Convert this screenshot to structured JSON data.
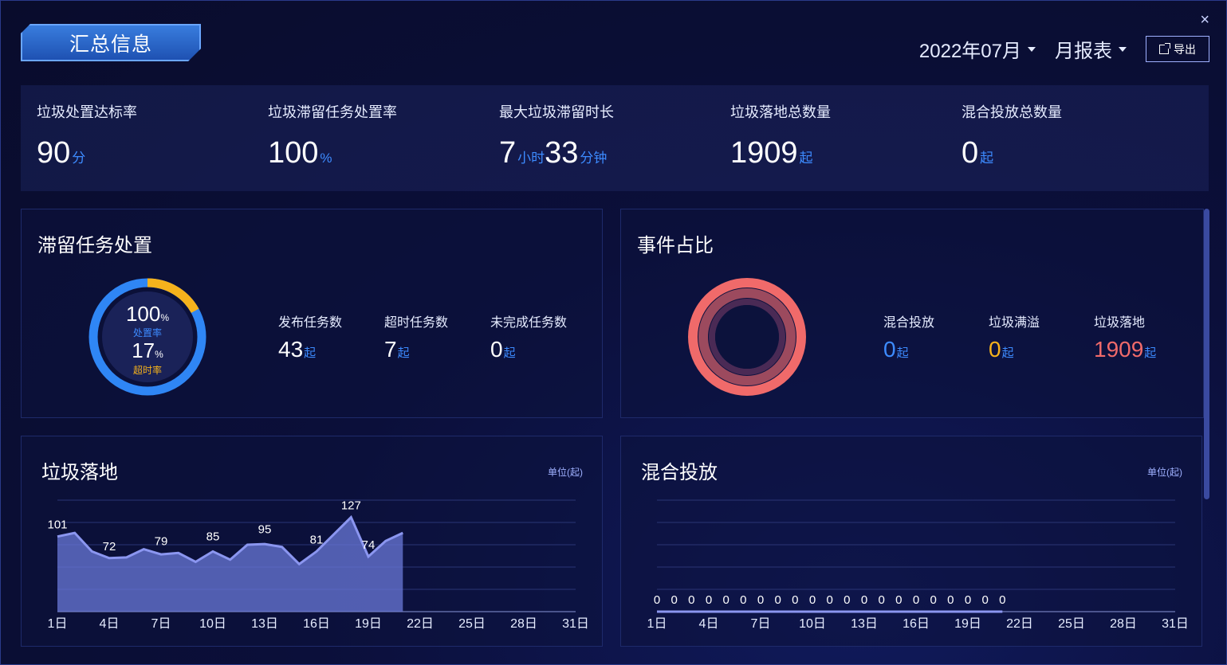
{
  "header": {
    "title": "汇总信息",
    "close_label": "×",
    "month_select": "2022年07月",
    "report_select": "月报表",
    "export_label": "导出"
  },
  "kpis": [
    {
      "label": "垃圾处置达标率",
      "value": "90",
      "unit": "分"
    },
    {
      "label": "垃圾滞留任务处置率",
      "value": "100",
      "unit": "%"
    },
    {
      "label": "最大垃圾滞留时长",
      "value": "7",
      "unit": "小时",
      "value2": "33",
      "unit2": "分钟"
    },
    {
      "label": "垃圾落地总数量",
      "value": "1909",
      "unit": "起"
    },
    {
      "label": "混合投放总数量",
      "value": "0",
      "unit": "起"
    }
  ],
  "retention": {
    "title": "滞留任务处置",
    "ring": {
      "top_value": "100",
      "top_unit": "%",
      "top_label": "处置率",
      "bottom_value": "17",
      "bottom_unit": "%",
      "bottom_label": "超时率",
      "overtime_fraction": 0.17
    },
    "stats": [
      {
        "label": "发布任务数",
        "value": "43",
        "unit": "起"
      },
      {
        "label": "超时任务数",
        "value": "7",
        "unit": "起"
      },
      {
        "label": "未完成任务数",
        "value": "0",
        "unit": "起"
      }
    ]
  },
  "events": {
    "title": "事件占比",
    "stats": [
      {
        "label": "混合投放",
        "value": "0",
        "unit": "起",
        "color": "#3d8bff"
      },
      {
        "label": "垃圾满溢",
        "value": "0",
        "unit": "起",
        "color": "#f5b21c"
      },
      {
        "label": "垃圾落地",
        "value": "1909",
        "unit": "起",
        "color": "#f06a6a"
      }
    ]
  },
  "colors": {
    "accent": "#3d8bff",
    "warning": "#f5b21c",
    "danger": "#f06a6a",
    "area": "#6a78d8"
  },
  "chart_data": [
    {
      "type": "area",
      "title": "垃圾落地",
      "unit_note": "单位(起)",
      "x_ticks": [
        "1日",
        "4日",
        "7日",
        "10日",
        "13日",
        "16日",
        "19日",
        "22日",
        "25日",
        "28日",
        "31日"
      ],
      "x": [
        1,
        2,
        3,
        4,
        5,
        6,
        7,
        8,
        9,
        10,
        11,
        12,
        13,
        14,
        15,
        16,
        17,
        18,
        19,
        20,
        21
      ],
      "values": [
        101,
        106,
        81,
        72,
        73,
        84,
        77,
        79,
        67,
        81,
        70,
        90,
        91,
        87,
        64,
        81,
        104,
        127,
        74,
        95,
        106
      ],
      "labels": [
        {
          "x": 1,
          "y": 101,
          "text": "101"
        },
        {
          "x": 4,
          "y": 72,
          "text": "72"
        },
        {
          "x": 7,
          "y": 79,
          "text": "79"
        },
        {
          "x": 10,
          "y": 85,
          "text": "85"
        },
        {
          "x": 13,
          "y": 95,
          "text": "95"
        },
        {
          "x": 16,
          "y": 81,
          "text": "81"
        },
        {
          "x": 18,
          "y": 127,
          "text": "127"
        },
        {
          "x": 19,
          "y": 74,
          "text": "74"
        }
      ],
      "xlim": [
        1,
        31
      ],
      "ylim": [
        0,
        150
      ],
      "grid": true
    },
    {
      "type": "area",
      "title": "混合投放",
      "unit_note": "单位(起)",
      "x_ticks": [
        "1日",
        "4日",
        "7日",
        "10日",
        "13日",
        "16日",
        "19日",
        "22日",
        "25日",
        "28日",
        "31日"
      ],
      "x": [
        1,
        2,
        3,
        4,
        5,
        6,
        7,
        8,
        9,
        10,
        11,
        12,
        13,
        14,
        15,
        16,
        17,
        18,
        19,
        20,
        21
      ],
      "values": [
        0,
        0,
        0,
        0,
        0,
        0,
        0,
        0,
        0,
        0,
        0,
        0,
        0,
        0,
        0,
        0,
        0,
        0,
        0,
        0,
        0
      ],
      "labels_all": true,
      "xlim": [
        1,
        31
      ],
      "ylim": [
        0,
        150
      ],
      "grid": true
    }
  ]
}
